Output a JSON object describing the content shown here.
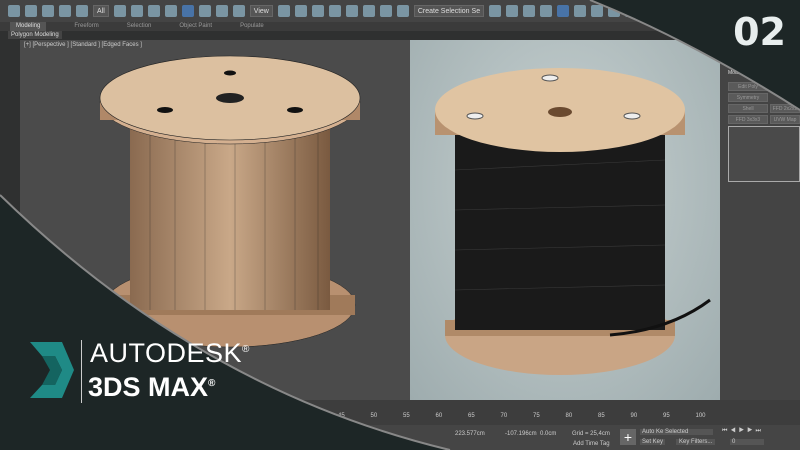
{
  "toolbar": {
    "selection_filter": "All",
    "ref_coord": "View",
    "named_selection": "Create Selection Se"
  },
  "ribbon": {
    "tabs": [
      "Modeling",
      "Freeform",
      "Selection",
      "Object Paint",
      "Populate"
    ],
    "active": "Modeling",
    "panel": "Polygon Modeling"
  },
  "viewport": {
    "label": "[+] [Perspective ] [Standard ] [Edged Faces ]"
  },
  "modifier_panel": {
    "title": "Modifier List",
    "buttons": [
      "Edit Poly",
      "Symmetry",
      "Shell",
      "FFD 3x3x3",
      "FFD 2x2x2",
      "UVW Map"
    ]
  },
  "timeline": {
    "ticks": [
      "45",
      "50",
      "55",
      "60",
      "65",
      "70",
      "75",
      "80",
      "85",
      "90",
      "95",
      "100"
    ]
  },
  "status": {
    "x": "223.577cm",
    "y": "-107.196cm",
    "z": "0.0cm",
    "grid": "Grid = 25,4cm",
    "add_time_tag": "Add Time Tag",
    "auto_key": "Auto Key",
    "set_key": "Set Key",
    "selected": "Selected",
    "key_filters": "Key Filters...",
    "frame": "0"
  },
  "overlay": {
    "episode": "02",
    "brand": "AUTODESK",
    "product": "3DS MAX",
    "reg": "®",
    "accent": "#1f8a86"
  }
}
